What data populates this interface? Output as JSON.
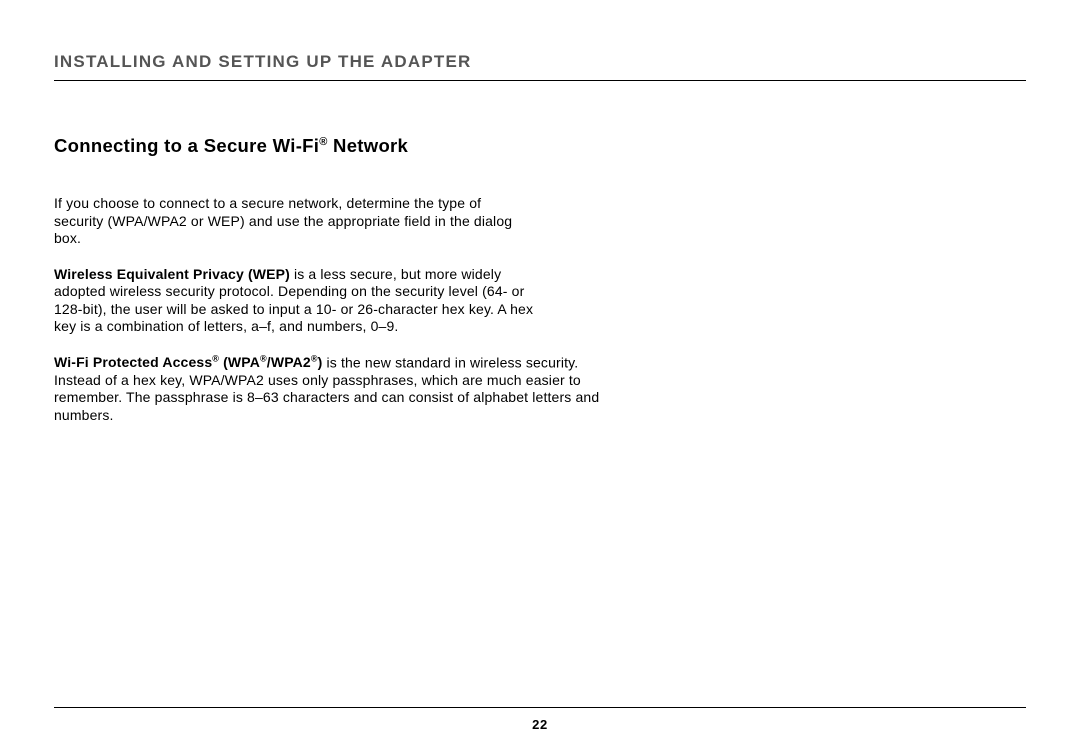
{
  "chapter": "INSTALLING AND SETTING UP THE ADAPTER",
  "section_prefix": "Connecting to a Secure Wi-Fi",
  "section_suffix": " Network",
  "reg": "®",
  "para1": "If you choose to connect to a secure network, determine the type of security (WPA/WPA2 or WEP) and use the appropriate field in the dialog box.",
  "para2_bold": "Wireless Equivalent Privacy (WEP)",
  "para2_rest": " is a less secure, but more widely adopted wireless security protocol. Depending on the security level (64- or 128-bit), the user will be asked to input a 10- or 26-character hex key. A hex key is a combination of letters, a–f, and numbers, 0–9.",
  "para3_bold_a": "Wi-Fi Protected Access",
  "para3_bold_b": " (WPA",
  "para3_bold_c": "/WPA2",
  "para3_bold_d": ")",
  "para3_rest": " is the new standard in wireless security. Instead of a hex key, WPA/WPA2 uses only passphrases, which are much easier to remember. The passphrase is 8–63 characters and can consist of alphabet letters and numbers.",
  "page_number": "22"
}
